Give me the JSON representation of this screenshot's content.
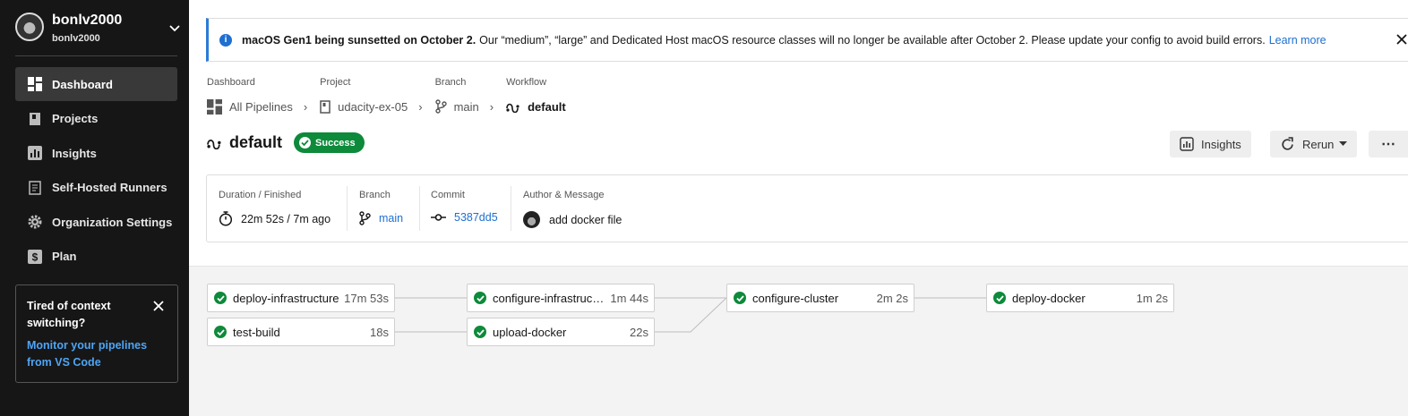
{
  "org": {
    "name": "bonlv2000",
    "sub": "bonlv2000"
  },
  "nav": [
    {
      "label": "Dashboard",
      "icon": "dashboard-icon",
      "active": true
    },
    {
      "label": "Projects",
      "icon": "projects-icon"
    },
    {
      "label": "Insights",
      "icon": "insights-icon"
    },
    {
      "label": "Self-Hosted Runners",
      "icon": "runners-icon"
    },
    {
      "label": "Organization Settings",
      "icon": "gear-icon"
    },
    {
      "label": "Plan",
      "icon": "plan-icon"
    }
  ],
  "promo": {
    "title": "Tired of context switching?",
    "link": "Monitor your pipelines from VS Code"
  },
  "banner": {
    "bold": "macOS Gen1 being sunsetted on October 2.",
    "text": "Our “medium”, “large” and Dedicated Host macOS resource classes will no longer be available after October 2. Please update your config to avoid build errors.",
    "link": "Learn more"
  },
  "breadcrumbs": [
    {
      "label": "Dashboard",
      "value": "All Pipelines"
    },
    {
      "label": "Project",
      "value": "udacity-ex-05"
    },
    {
      "label": "Branch",
      "value": "main"
    },
    {
      "label": "Workflow",
      "value": "default"
    }
  ],
  "workflow": {
    "name": "default",
    "status": "Success"
  },
  "buttons": {
    "insights": "Insights",
    "rerun": "Rerun",
    "more": "⋯"
  },
  "summary": {
    "duration_label": "Duration / Finished",
    "duration_value": "22m 52s / 7m ago",
    "branch_label": "Branch",
    "branch_value": "main",
    "commit_label": "Commit",
    "commit_value": "5387dd5",
    "author_label": "Author & Message",
    "message": "add docker file"
  },
  "jobs": [
    {
      "name": "deploy-infrastructure",
      "time": "17m 53s"
    },
    {
      "name": "test-build",
      "time": "18s"
    },
    {
      "name": "configure-infrastructure",
      "time": "1m 44s"
    },
    {
      "name": "upload-docker",
      "time": "22s"
    },
    {
      "name": "configure-cluster",
      "time": "2m 2s"
    },
    {
      "name": "deploy-docker",
      "time": "1m 2s"
    }
  ],
  "colors": {
    "success": "#0d8a3a",
    "link": "#1e6fd0",
    "sidebar": "#161616"
  }
}
